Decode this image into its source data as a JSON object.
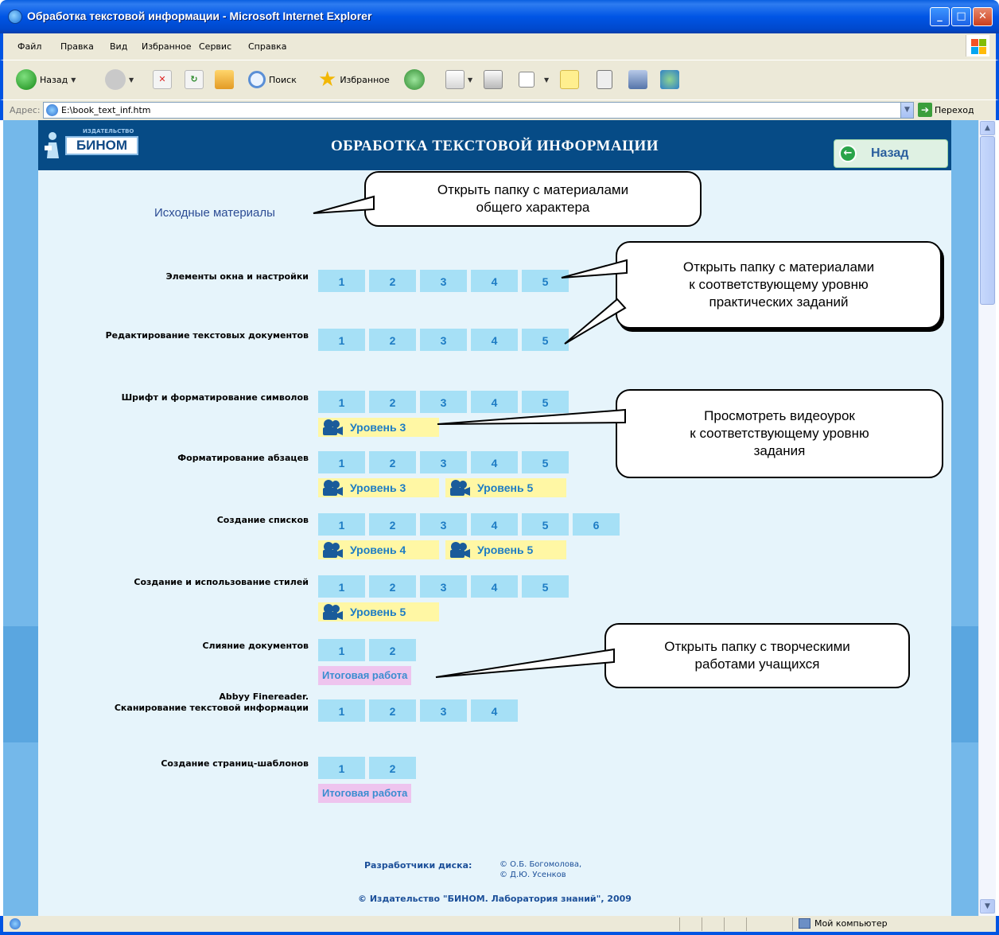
{
  "window": {
    "title": "Обработка текстовой информации - Microsoft Internet Explorer",
    "controls": {
      "minimize": "_",
      "maximize": "□",
      "close": "✕"
    }
  },
  "menu": [
    "Файл",
    "Правка",
    "Вид",
    "Избранное",
    "Сервис",
    "Справка"
  ],
  "toolbar": {
    "back": "Назад",
    "search": "Поиск",
    "favorites": "Избранное"
  },
  "address": {
    "label": "Адрес:",
    "value": "E:\\book_text_inf.htm",
    "go": "Переход"
  },
  "page": {
    "publisher_small": "ИЗДАТЕЛЬСТВО",
    "publisher": "БИНОМ",
    "title": "ОБРАБОТКА ТЕКСТОВОЙ ИНФОРМАЦИИ",
    "back_button": "Назад",
    "source_materials": "Исходные материалы",
    "topics": [
      {
        "label": "Элементы окна и настройки",
        "levels": [
          "1",
          "2",
          "3",
          "4",
          "5"
        ],
        "videos": [],
        "final": ""
      },
      {
        "label": "Редактирование текстовых документов",
        "levels": [
          "1",
          "2",
          "3",
          "4",
          "5"
        ],
        "videos": [],
        "final": ""
      },
      {
        "label": "Шрифт и форматирование символов",
        "levels": [
          "1",
          "2",
          "3",
          "4",
          "5"
        ],
        "videos": [
          "Уровень 3"
        ],
        "final": ""
      },
      {
        "label": "Форматирование абзацев",
        "levels": [
          "1",
          "2",
          "3",
          "4",
          "5"
        ],
        "videos": [
          "Уровень 3",
          "Уровень 5"
        ],
        "final": ""
      },
      {
        "label": "Создание списков",
        "levels": [
          "1",
          "2",
          "3",
          "4",
          "5",
          "6"
        ],
        "videos": [
          "Уровень 4",
          "Уровень 5"
        ],
        "final": ""
      },
      {
        "label": "Создание и использование стилей",
        "levels": [
          "1",
          "2",
          "3",
          "4",
          "5"
        ],
        "videos": [
          "Уровень 5"
        ],
        "final": ""
      },
      {
        "label": "Слияние документов",
        "levels": [
          "1",
          "2"
        ],
        "videos": [],
        "final": "Итоговая работа"
      },
      {
        "label": "Abbyy Finereader.\nСканирование текстовой информации",
        "levels": [
          "1",
          "2",
          "3",
          "4"
        ],
        "videos": [],
        "final": ""
      },
      {
        "label": "Создание страниц-шаблонов",
        "levels": [
          "1",
          "2"
        ],
        "videos": [],
        "final": "Итоговая работа"
      }
    ],
    "credits_label": "Разработчики диска:",
    "credits_names": [
      "© О.Б. Богомолова,",
      "© Д.Ю. Усенков"
    ],
    "copyright": "© Издательство \"БИНОМ. Лаборатория знаний\", 2009"
  },
  "callouts": [
    "Открыть папку с материалами\nобщего характера",
    "Открыть папку с материалами\nк соответствующему уровню\nпрактических заданий",
    "Просмотреть видеоурок\nк соответствующему уровню\nзадания",
    "Открыть папку с творческими\nработами учащихся"
  ],
  "status": {
    "zone": "Мой компьютер"
  },
  "colors": {
    "header": "#064b86",
    "level_button": "#a6e0f6",
    "video_button": "#fff7a4",
    "final_button": "#eec4ee",
    "page_bg": "#e6f4fb"
  }
}
